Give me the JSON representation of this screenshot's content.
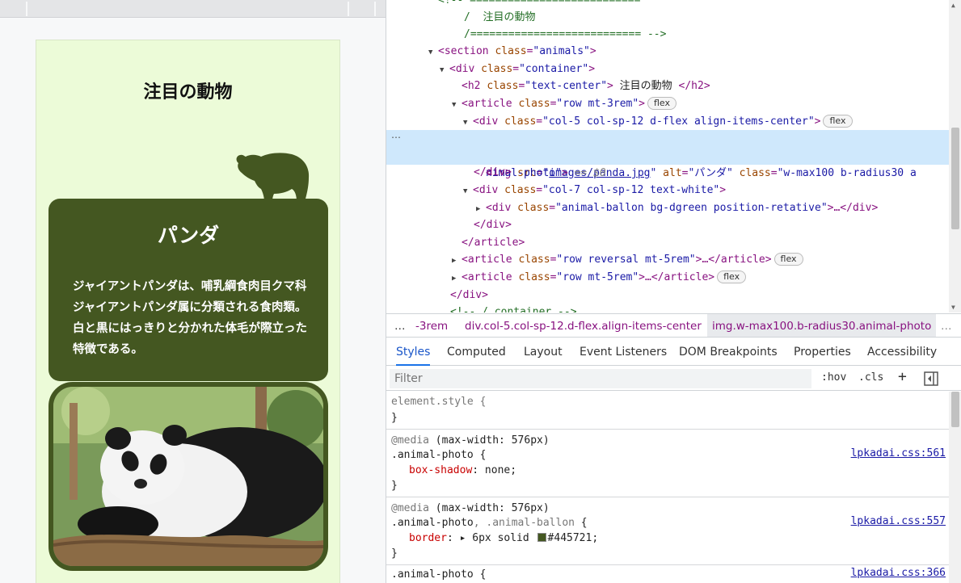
{
  "preview": {
    "section_title": "注目の動物",
    "animal_name": "パンダ",
    "description": "ジャイアントパンダは、哺乳綱食肉目クマ科ジャイアントパンダ属に分類される食肉類。白と黒にはっきりと分かれた体毛が際立った特徴である。",
    "bear_icon": "bear-silhouette-icon",
    "photo_alt": "パンダ",
    "accent_color": "#445721",
    "page_bg": "#ecfbd8"
  },
  "dom_lines": {
    "l0": "<!-- ===========================",
    "l1": "/  注目の動物",
    "l2": "/=========================== -->",
    "l3_tag": "<section ",
    "l3_attr": "class",
    "l3_val": "\"animals\"",
    "l4_tag": "<div ",
    "l4_attr": "class",
    "l4_val": "\"container\"",
    "l5_tag": "<h2 ",
    "l5_attr": "class",
    "l5_val": "\"text-center\"",
    "l5_text": " 注目の動物 ",
    "l5_close": "</h2>",
    "l6_tag": "<article ",
    "l6_attr": "class",
    "l6_val": "\"row mt-3rem\"",
    "l7_tag": "<div ",
    "l7_attr": "class",
    "l7_val": "\"col-5 col-sp-12 d-flex align-items-center\"",
    "l8_tag": "<img ",
    "l8_attr1": "src",
    "l8_val1": "images/panda.jpg",
    "l8_attr2": "alt",
    "l8_val2": "\"パンダ\"",
    "l8_attr3": "class",
    "l8_val3a": "\"w-max100 b-radius30 a",
    "l8_val3b": "nimal-photo\"",
    "l8_eq": "== $0",
    "l9": "</div>",
    "l10_tag": "<div ",
    "l10_attr": "class",
    "l10_val": "\"col-7 col-sp-12 text-white\"",
    "l11_tag": "<div ",
    "l11_attr": "class",
    "l11_val": "\"animal-ballon bg-dgreen position-retative\"",
    "l11_close": "…</div>",
    "l12": "</div>",
    "l13": "</article>",
    "l14_tag": "<article ",
    "l14_attr": "class",
    "l14_val": "\"row reversal mt-5rem\"",
    "l14_close": "…</article>",
    "l15_tag": "<article ",
    "l15_attr": "class",
    "l15_val": "\"row mt-5rem\"",
    "l15_close": "…</article>",
    "l16": "</div>",
    "l17": "<!-- /.container -->",
    "flex_badge": "flex",
    "ellipsis": "…"
  },
  "breadcrumb": {
    "dots": "…",
    "items": [
      "-3rem",
      "div.col-5.col-sp-12.d-flex.align-items-center",
      "img.w-max100.b-radius30.animal-photo"
    ],
    "more": "…"
  },
  "tabs": [
    "Styles",
    "Computed",
    "Layout",
    "Event Listeners",
    "DOM Breakpoints",
    "Properties",
    "Accessibility"
  ],
  "active_tab": "Styles",
  "filter": {
    "placeholder": "Filter",
    "hov": ":hov",
    "cls": ".cls",
    "plus": "+"
  },
  "styles": {
    "r0_selector": "element.style {",
    "r0_close": "}",
    "r1_media": "@media",
    "r1_query": " (max-width: 576px)",
    "r1_selector": ".animal-photo {",
    "r1_source": "lpkadai.css:561",
    "r1_prop": "box-shadow",
    "r1_value": ": none;",
    "r1_close": "}",
    "r2_media": "@media",
    "r2_query": " (max-width: 576px)",
    "r2_selector_a": ".animal-photo",
    "r2_selector_b": ", .animal-ballon",
    "r2_brace": " {",
    "r2_source": "lpkadai.css:557",
    "r2_prop": "border",
    "r2_value_a": ": ▸ 6px solid ",
    "r2_value_b": "#445721;",
    "r2_close": "}",
    "r3_selector": ".animal-photo {",
    "r3_source": "lpkadai.css:366"
  }
}
